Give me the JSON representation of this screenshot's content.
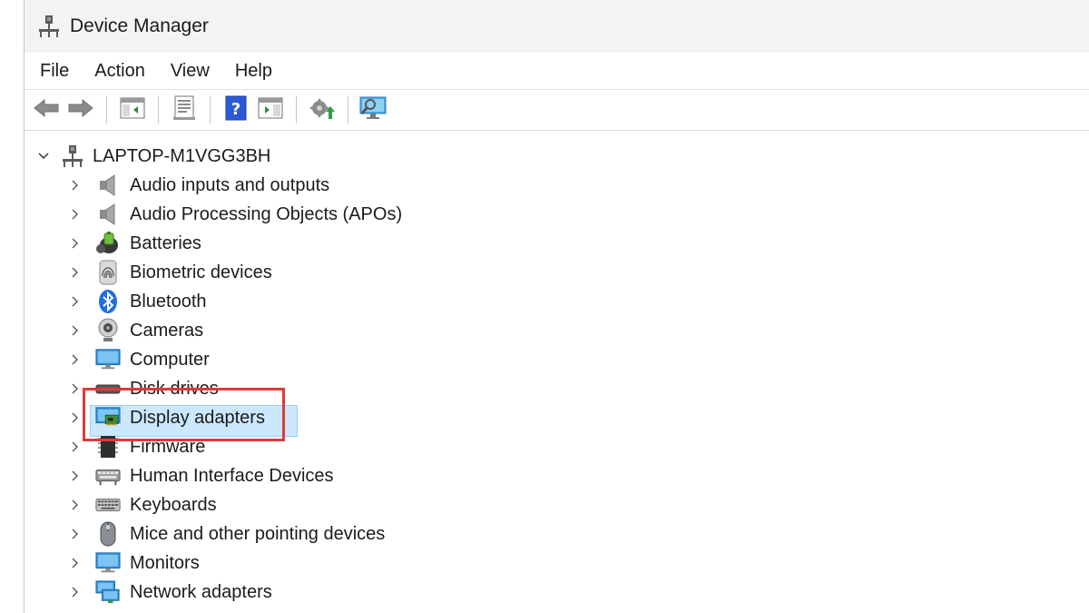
{
  "window": {
    "title": "Device Manager"
  },
  "menu": [
    "File",
    "Action",
    "View",
    "Help"
  ],
  "toolbar": {
    "buttons": [
      {
        "icon": "back-arrow-icon"
      },
      {
        "icon": "forward-arrow-icon"
      },
      {
        "icon": "show-hide-console-tree-icon"
      },
      {
        "icon": "properties-icon"
      },
      {
        "icon": "help-icon"
      },
      {
        "icon": "show-action-pane-icon"
      },
      {
        "icon": "update-driver-icon"
      },
      {
        "icon": "scan-hardware-changes-icon"
      }
    ]
  },
  "tree": {
    "root": {
      "label": "LAPTOP-M1VGG3BH",
      "icon": "computer-network-icon",
      "expanded": true
    },
    "items": [
      {
        "label": "Audio inputs and outputs",
        "icon": "speaker-icon"
      },
      {
        "label": "Audio Processing Objects (APOs)",
        "icon": "speaker-icon"
      },
      {
        "label": "Batteries",
        "icon": "battery-icon"
      },
      {
        "label": "Biometric devices",
        "icon": "fingerprint-icon"
      },
      {
        "label": "Bluetooth",
        "icon": "bluetooth-icon"
      },
      {
        "label": "Cameras",
        "icon": "webcam-icon"
      },
      {
        "label": "Computer",
        "icon": "monitor-icon"
      },
      {
        "label": "Disk drives",
        "icon": "disk-drive-icon"
      },
      {
        "label": "Display adapters",
        "icon": "display-adapter-icon",
        "selected": true
      },
      {
        "label": "Firmware",
        "icon": "chip-icon"
      },
      {
        "label": "Human Interface Devices",
        "icon": "hid-icon"
      },
      {
        "label": "Keyboards",
        "icon": "keyboard-icon"
      },
      {
        "label": "Mice and other pointing devices",
        "icon": "mouse-icon"
      },
      {
        "label": "Monitors",
        "icon": "monitor-icon"
      },
      {
        "label": "Network adapters",
        "icon": "network-adapter-icon"
      }
    ]
  },
  "colors": {
    "selection": "#cce8ff",
    "highlight_border": "#e03a3a"
  }
}
